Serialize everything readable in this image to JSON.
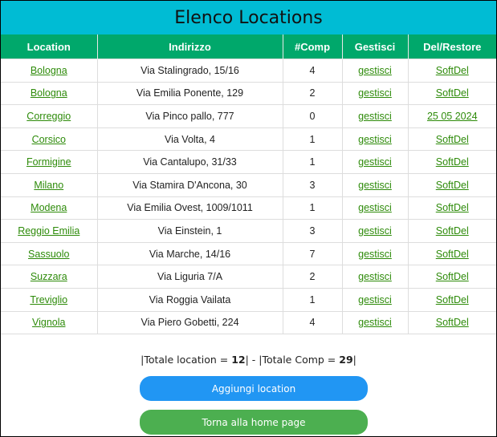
{
  "page": {
    "title": "Elenco Locations"
  },
  "table": {
    "headers": [
      "Location",
      "Indirizzo",
      "#Comp",
      "Gestisci",
      "Del/Restore"
    ],
    "rows": [
      {
        "location": "Bologna",
        "address": "Via Stalingrado, 15/16",
        "comp": "4",
        "manage": "gestisci",
        "action": "SoftDel"
      },
      {
        "location": "Bologna",
        "address": "Via Emilia Ponente, 129",
        "comp": "2",
        "manage": "gestisci",
        "action": "SoftDel"
      },
      {
        "location": "Correggio",
        "address": "Via Pinco pallo, 777",
        "comp": "0",
        "manage": "gestisci",
        "action": "25 05 2024"
      },
      {
        "location": "Corsico",
        "address": "Via Volta, 4",
        "comp": "1",
        "manage": "gestisci",
        "action": "SoftDel"
      },
      {
        "location": "Formigine",
        "address": "Via Cantalupo, 31/33",
        "comp": "1",
        "manage": "gestisci",
        "action": "SoftDel"
      },
      {
        "location": "Milano",
        "address": "Via Stamira D'Ancona, 30",
        "comp": "3",
        "manage": "gestisci",
        "action": "SoftDel"
      },
      {
        "location": "Modena",
        "address": "Via Emilia Ovest, 1009/1011",
        "comp": "1",
        "manage": "gestisci",
        "action": "SoftDel"
      },
      {
        "location": "Reggio Emilia",
        "address": "Via Einstein, 1",
        "comp": "3",
        "manage": "gestisci",
        "action": "SoftDel"
      },
      {
        "location": "Sassuolo",
        "address": "Via Marche, 14/16",
        "comp": "7",
        "manage": "gestisci",
        "action": "SoftDel"
      },
      {
        "location": "Suzzara",
        "address": "Via Liguria 7/A",
        "comp": "2",
        "manage": "gestisci",
        "action": "SoftDel"
      },
      {
        "location": "Treviglio",
        "address": "Via Roggia Vailata",
        "comp": "1",
        "manage": "gestisci",
        "action": "SoftDel"
      },
      {
        "location": "Vignola",
        "address": "Via Piero Gobetti, 224",
        "comp": "4",
        "manage": "gestisci",
        "action": "SoftDel"
      }
    ]
  },
  "totals": {
    "prefix": "|Totale location = ",
    "location_count": "12",
    "middle": "| - |Totale Comp = ",
    "comp_count": "29",
    "suffix": "|"
  },
  "buttons": {
    "add_location": "Aggiungi location",
    "home": "Torna alla home page"
  },
  "colors": {
    "title_bar": "#00bcd4",
    "header_row": "#00a86b",
    "link": "#2e8b0a",
    "add_button": "#2196f3",
    "home_button": "#4caf50"
  }
}
